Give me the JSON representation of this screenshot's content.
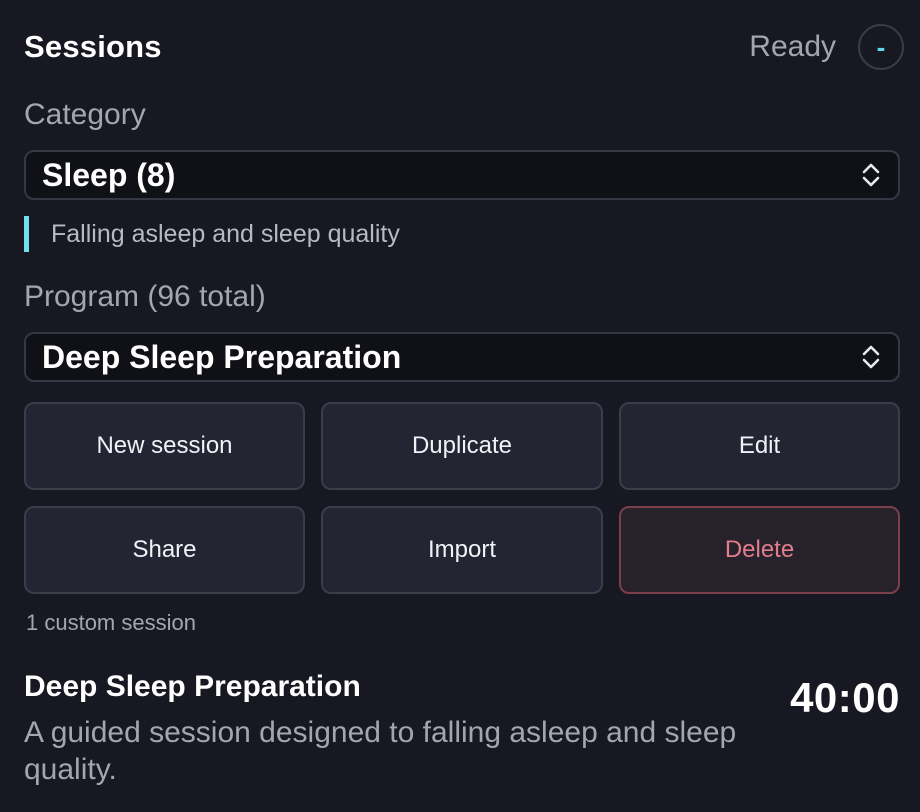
{
  "header": {
    "title": "Sessions",
    "status": "Ready",
    "status_button_symbol": "-"
  },
  "category": {
    "label": "Category",
    "selected": "Sleep (8)",
    "description": "Falling asleep and sleep quality"
  },
  "program": {
    "label": "Program (96 total)",
    "selected": "Deep Sleep Preparation"
  },
  "actions": {
    "new_session": "New session",
    "duplicate": "Duplicate",
    "edit": "Edit",
    "share": "Share",
    "import": "Import",
    "delete": "Delete"
  },
  "custom_count": "1 custom session",
  "details": {
    "name": "Deep Sleep Preparation",
    "duration": "40:00",
    "description": "A guided session designed to falling asleep and sleep quality."
  },
  "colors": {
    "background": "#171821",
    "accent": "#6fe0ec",
    "danger": "#e07e8d"
  },
  "icons": {
    "select_indicator": "chevron-up-down-icon",
    "status_button": "minus-icon"
  }
}
